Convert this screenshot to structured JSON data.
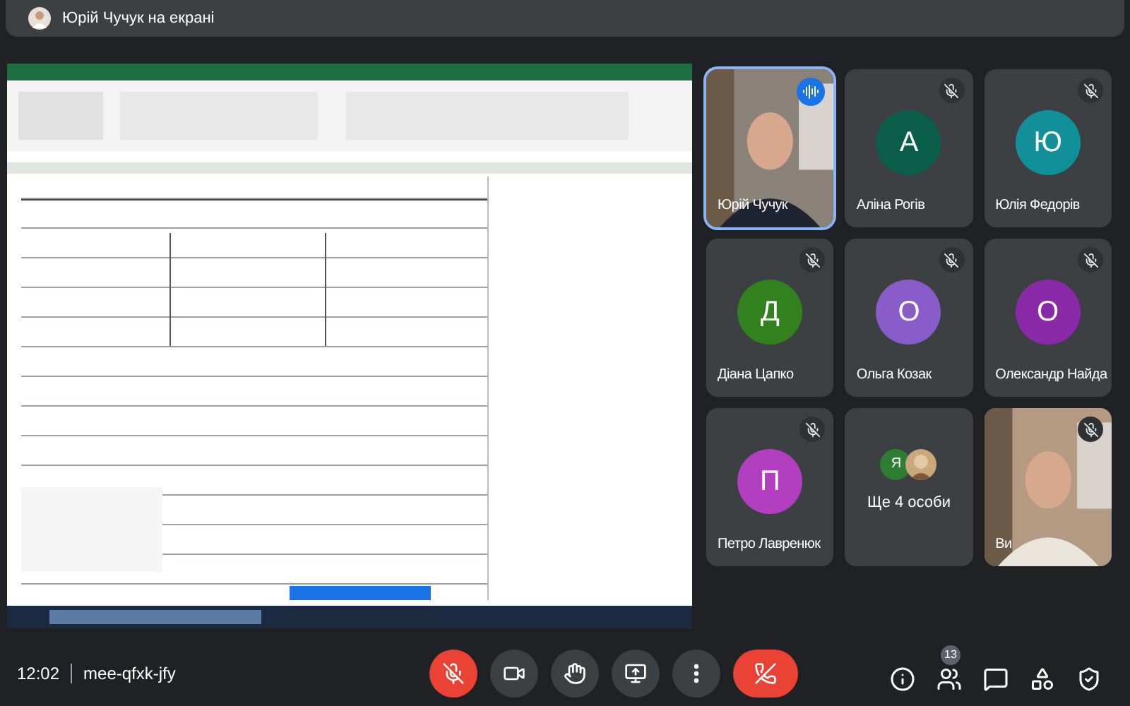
{
  "presenter_bar": {
    "title": "Юрій Чучук на екрані"
  },
  "participants": [
    {
      "kind": "video",
      "name": "Юрій Чучук",
      "muted": false,
      "speaking": true
    },
    {
      "kind": "avatar",
      "name": "Аліна Рогів",
      "initial": "А",
      "color": "#0b5e48",
      "muted": true,
      "speaking": false
    },
    {
      "kind": "avatar",
      "name": "Юлія Федорів",
      "initial": "Ю",
      "color": "#12909a",
      "muted": true,
      "speaking": false
    },
    {
      "kind": "avatar",
      "name": "Діана Цапко",
      "initial": "Д",
      "color": "#33801f",
      "muted": true,
      "speaking": false
    },
    {
      "kind": "avatar",
      "name": "Ольга Козак",
      "initial": "О",
      "color": "#8a5cc9",
      "muted": true,
      "speaking": false
    },
    {
      "kind": "avatar",
      "name": "Олександр Найда",
      "initial": "О",
      "color": "#8a2aa8",
      "muted": true,
      "speaking": false
    },
    {
      "kind": "avatar",
      "name": "Петро Лавренюк",
      "initial": "П",
      "color": "#b23fc0",
      "muted": true,
      "speaking": false
    },
    {
      "kind": "more",
      "name": "Ще 4 особи",
      "initial": "Я",
      "color": "#2e7d32",
      "muted": false,
      "speaking": false
    },
    {
      "kind": "video",
      "name": "Ви",
      "muted": true,
      "speaking": false
    }
  ],
  "footer": {
    "time": "12:02",
    "meeting_code": "mee-qfxk-jfy",
    "mic_muted": true,
    "people_count": "13"
  }
}
